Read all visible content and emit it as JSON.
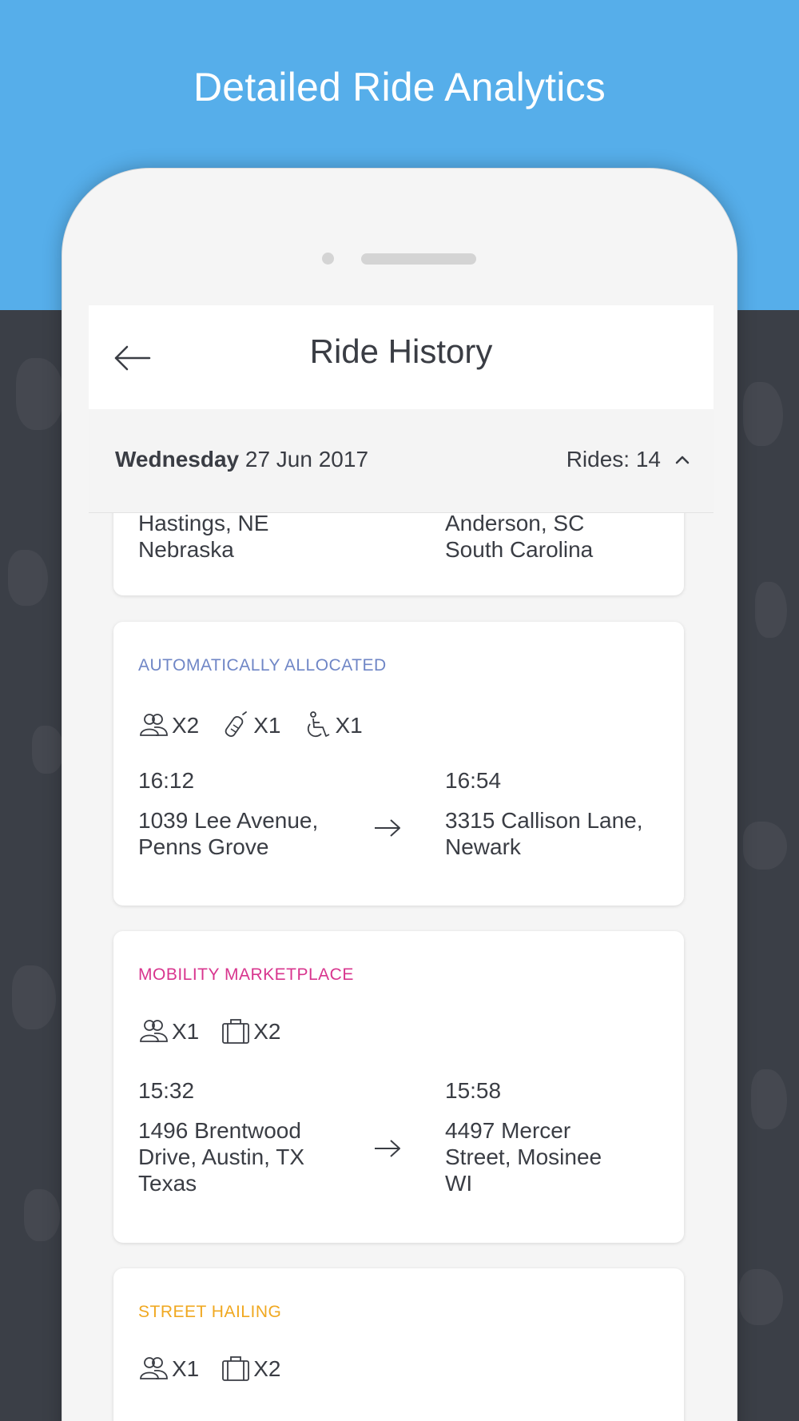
{
  "promo": {
    "title": "Detailed Ride Analytics"
  },
  "colors": {
    "bg_top": "#56aeea",
    "bg_bottom": "#3b3f47",
    "auto": "#6f86c6",
    "marketplace": "#d8358e",
    "street": "#f0a820",
    "text": "#3a3d44"
  },
  "nav": {
    "title": "Ride History",
    "back_icon": "arrow-left-icon"
  },
  "day_header": {
    "weekday": "Wednesday",
    "date": "27 Jun 2017",
    "rides": "Rides: 14",
    "toggle_icon": "chevron-up-icon"
  },
  "cards": [
    {
      "from_address": "Hastings, NE\nNebraska",
      "to_address": "Anderson, SC\nSouth Carolina"
    },
    {
      "label": "AUTOMATICALLY ALLOCATED",
      "icons": [
        {
          "icon": "passengers-icon",
          "count": "X2"
        },
        {
          "icon": "baby-bottle-icon",
          "count": "X1"
        },
        {
          "icon": "wheelchair-icon",
          "count": "X1"
        }
      ],
      "from_time": "16:12",
      "to_time": "16:54",
      "from_address": "1039 Lee Avenue,\nPenns Grove",
      "to_address": "3315 Callison Lane,\nNewark"
    },
    {
      "label": "MOBILITY MARKETPLACE",
      "icons": [
        {
          "icon": "passengers-icon",
          "count": "X1"
        },
        {
          "icon": "luggage-icon",
          "count": "X2"
        }
      ],
      "from_time": "15:32",
      "to_time": "15:58",
      "from_address": "1496 Brentwood\nDrive, Austin, TX\nTexas",
      "to_address": "4497 Mercer\nStreet, Mosinee\nWI"
    },
    {
      "label": "STREET HAILING",
      "icons": [
        {
          "icon": "passengers-icon",
          "count": "X1"
        },
        {
          "icon": "luggage-icon",
          "count": "X2"
        }
      ]
    }
  ]
}
